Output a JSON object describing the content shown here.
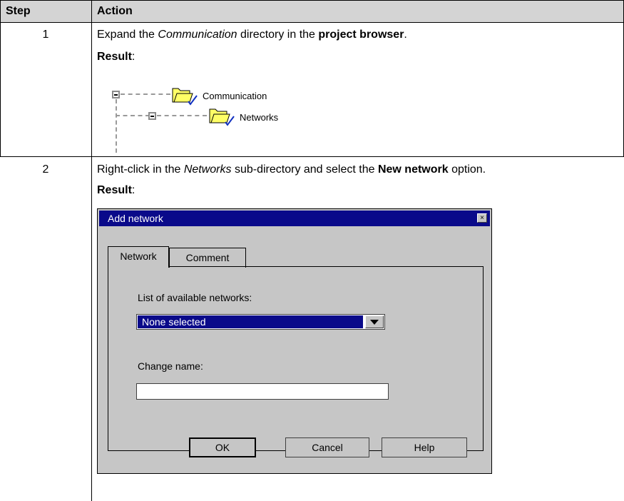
{
  "table": {
    "header": {
      "step": "Step",
      "action": "Action"
    },
    "rows": [
      {
        "step": "1",
        "action_pre": "Expand the ",
        "action_italic": "Communication",
        "action_mid": " directory in the ",
        "action_bold": "project browser",
        "action_post": ".",
        "result_label": "Result",
        "result_colon": ":"
      },
      {
        "step": "2",
        "action_pre": "Right-click in the ",
        "action_italic": "Networks",
        "action_mid": " sub-directory and select the ",
        "action_bold": "New network",
        "action_post": " option.",
        "result_label": "Result",
        "result_colon": ":"
      }
    ]
  },
  "tree": {
    "items": [
      {
        "label": "Communication",
        "icon": "folder-icon"
      },
      {
        "label": "Networks",
        "icon": "folder-icon"
      }
    ]
  },
  "dialog": {
    "title": "Add network",
    "close_glyph": "×",
    "tabs": [
      {
        "label": "Network",
        "active": true
      },
      {
        "label": "Comment",
        "active": false
      }
    ],
    "list_label": "List of available networks:",
    "list_selected": "None selected",
    "change_name_label": "Change name:",
    "change_name_value": "",
    "buttons": {
      "ok": "OK",
      "cancel": "Cancel",
      "help": "Help"
    },
    "colors": {
      "title_bar": "#0a0a8a",
      "face": "#c6c6c6",
      "folder": "#ffff66",
      "check": "#1030c0"
    }
  }
}
